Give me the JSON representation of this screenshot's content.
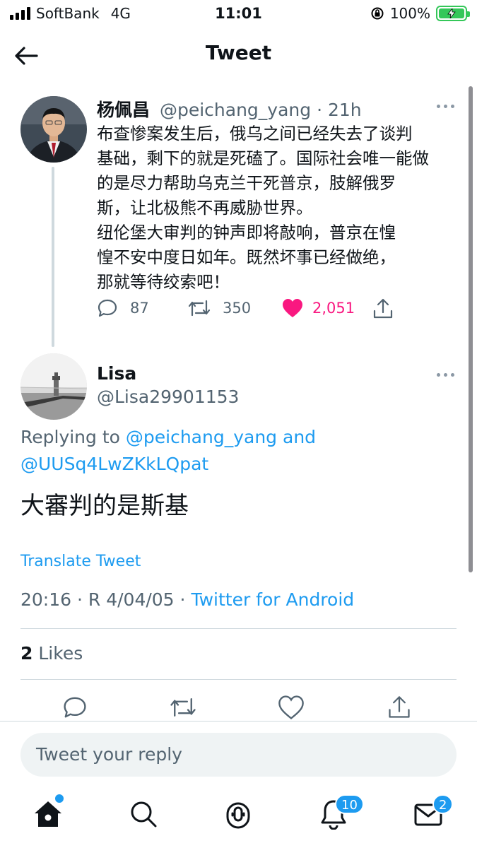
{
  "status_bar": {
    "carrier": "SoftBank",
    "network": "4G",
    "time": "11:01",
    "battery": "100%"
  },
  "header": {
    "title": "Tweet"
  },
  "parent_tweet": {
    "name": "杨佩昌",
    "handle": "@peichang_yang",
    "time": "· 21h",
    "lines": [
      "布查惨案发生后，俄乌之间已经失去了谈判",
      "基础，剩下的就是死磕了。国际社会唯一能做",
      "的是尽力帮助乌克兰干死普京，肢解俄罗",
      "斯，让北极熊不再威胁世界。",
      "纽伦堡大审判的钟声即将敲响，普京在惶",
      "惶不安中度日如年。既然坏事已经做绝，",
      "那就等待绞索吧！"
    ],
    "replies": "87",
    "retweets": "350",
    "likes": "2,051"
  },
  "reply_tweet": {
    "name": "Lisa",
    "handle": "@Lisa29901153",
    "replying_prefix": "Replying to ",
    "replying_user1": "@peichang_yang",
    "replying_and": " and",
    "replying_user2": "@UUSq4LwZKkLQpat",
    "text": "大審判的是斯基",
    "translate": "Translate Tweet",
    "timestamp": "20:16 · R 4/04/05 ·",
    "source": "Twitter for Android",
    "likes_count": "2",
    "likes_label": "Likes"
  },
  "compose": {
    "placeholder": "Tweet your reply"
  },
  "tabbar": {
    "notifications_badge": "10",
    "messages_badge": "2"
  },
  "colors": {
    "accent": "#1d9bf0",
    "like_pink": "#f91880",
    "battery_green": "#34c759"
  }
}
